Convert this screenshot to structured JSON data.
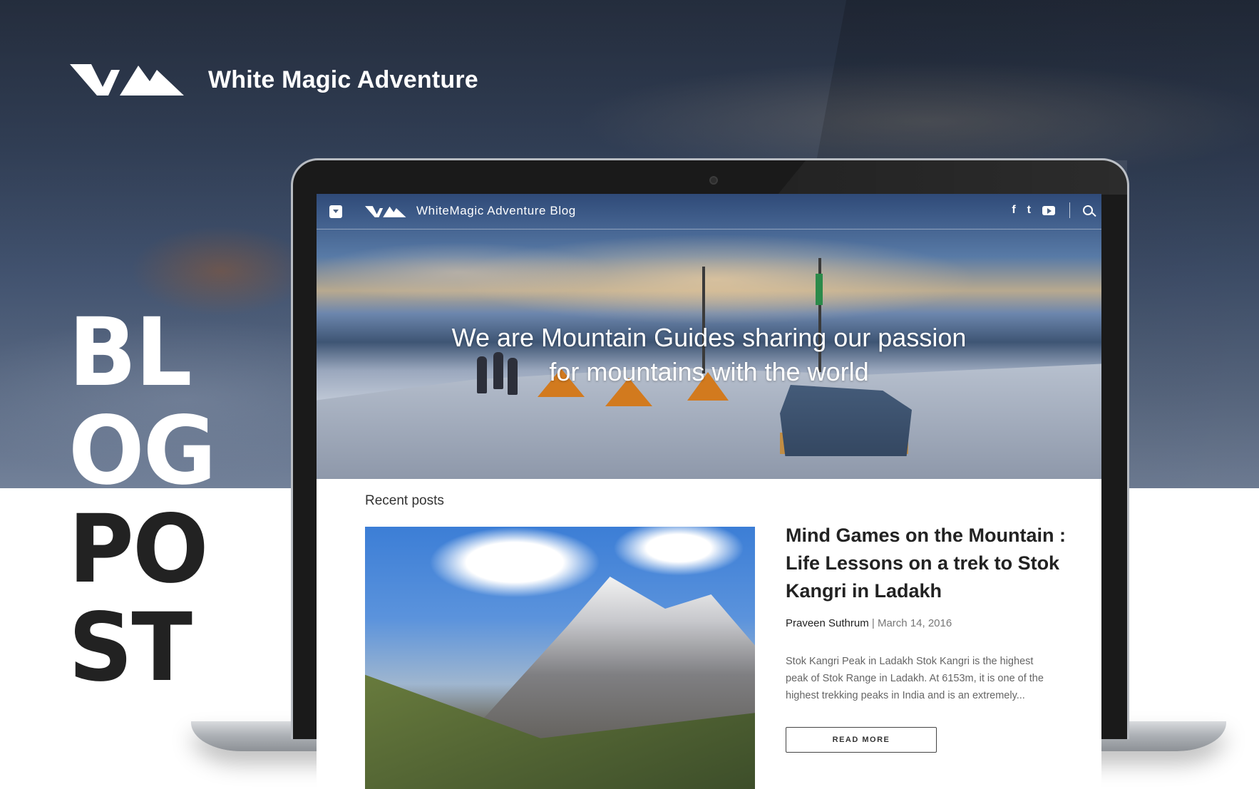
{
  "poster": {
    "brand_name": "White Magic Adventure",
    "stack_lines": [
      "BL",
      "OG",
      "PO",
      "ST"
    ]
  },
  "blog": {
    "nav_title": "WhiteMagic Adventure Blog",
    "social": {
      "facebook": "f",
      "twitter": "t"
    },
    "tagline_line1": "We are Mountain Guides sharing our passion",
    "tagline_line2": "for mountains with the world",
    "recent_label": "Recent posts",
    "post": {
      "title": "Mind Games on the Mountain : Life Lessons on a trek to Stok Kangri in Ladakh",
      "author": "Praveen Suthrum",
      "date": "| March 14, 2016",
      "excerpt": "Stok Kangri Peak in Ladakh  Stok Kangri is the highest peak of Stok Range in Ladakh. At 6153m, it is one of the highest trekking peaks in India and is an extremely...",
      "read_more": "READ MORE"
    }
  },
  "colors": {
    "brand_white": "#ffffff",
    "stack_dark": "#222222",
    "hero_blue": "#4a6080"
  },
  "icons": [
    "menu-icon",
    "brand-logo-icon",
    "facebook-icon",
    "twitter-icon",
    "youtube-icon",
    "search-icon"
  ]
}
